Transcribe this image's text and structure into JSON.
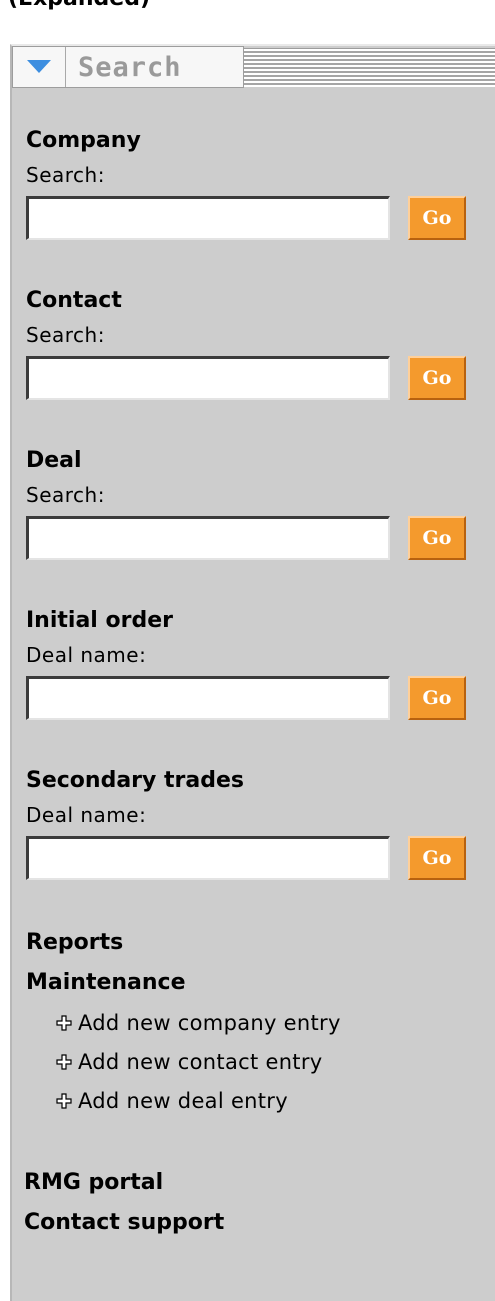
{
  "caption": "(Expanded)",
  "panel": {
    "tab_title": "Search",
    "sections": [
      {
        "title": "Company",
        "label": "Search:",
        "value": "",
        "button": "Go"
      },
      {
        "title": "Contact",
        "label": "Search:",
        "value": "",
        "button": "Go"
      },
      {
        "title": "Deal",
        "label": "Search:",
        "value": "",
        "button": "Go"
      },
      {
        "title": "Initial order",
        "label": "Deal name:",
        "value": "",
        "button": "Go"
      },
      {
        "title": "Secondary trades",
        "label": "Deal name:",
        "value": "",
        "button": "Go"
      }
    ],
    "reports": "Reports",
    "maintenance": {
      "title": "Maintenance",
      "items": [
        "Add new company entry",
        "Add new contact entry",
        "Add new deal entry"
      ]
    },
    "rmg_portal": "RMG portal",
    "contact_support": "Contact support"
  }
}
